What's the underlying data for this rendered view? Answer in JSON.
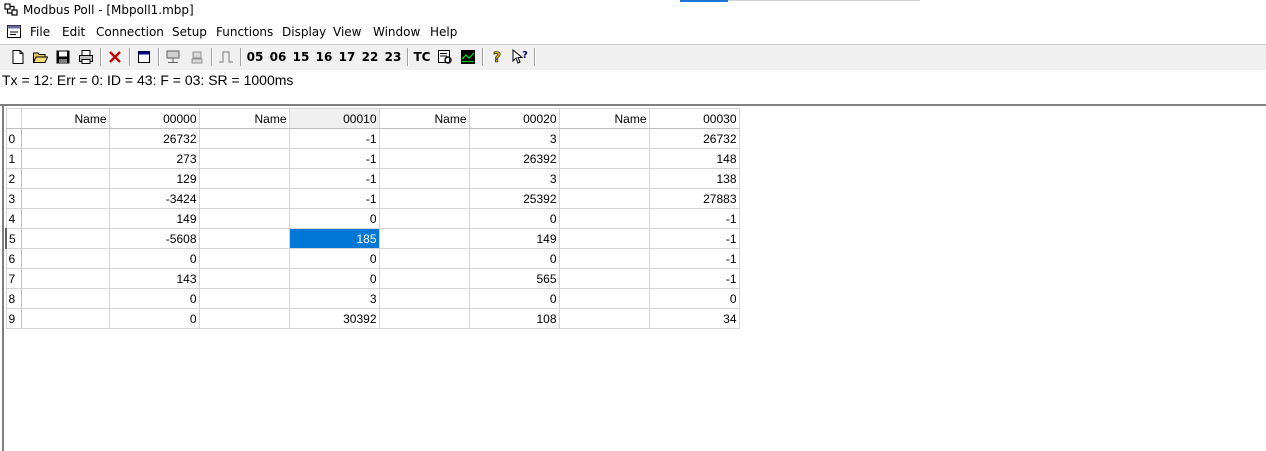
{
  "window": {
    "title": "Modbus Poll - [Mbpoll1.mbp]",
    "app_icon": "modbus-app-icon",
    "accent_color": "#1e73d6"
  },
  "menubar": {
    "doc_icon": "document-icon",
    "items": [
      "File",
      "Edit",
      "Connection",
      "Setup",
      "Functions",
      "Display",
      "View",
      "Window",
      "Help"
    ]
  },
  "toolbar": {
    "icons": [
      "new-icon",
      "open-icon",
      "save-icon",
      "print-icon",
      "delete-icon",
      "window-icon",
      "connect-icon",
      "disconnect-icon",
      "pulse-icon",
      "traffic-icon",
      "chart-icon",
      "help-icon",
      "context-help-icon"
    ],
    "function_codes": [
      "05",
      "06",
      "15",
      "16",
      "17",
      "22",
      "23"
    ],
    "tc_label": "TC"
  },
  "status": {
    "text": "Tx = 12: Err = 0: ID = 43: F = 03: SR = 1000ms"
  },
  "grid": {
    "header_name": "Name",
    "column_addresses": [
      "00000",
      "00010",
      "00020",
      "00030"
    ],
    "active_column_index": 1,
    "selected_cell": {
      "row": 5,
      "col": 1
    },
    "selection_color": "#0078d7",
    "rows": [
      {
        "index": "0",
        "values": [
          "26732",
          "-1",
          "3",
          "26732"
        ]
      },
      {
        "index": "1",
        "values": [
          "273",
          "-1",
          "26392",
          "148"
        ]
      },
      {
        "index": "2",
        "values": [
          "129",
          "-1",
          "3",
          "138"
        ]
      },
      {
        "index": "3",
        "values": [
          "-3424",
          "-1",
          "25392",
          "27883"
        ]
      },
      {
        "index": "4",
        "values": [
          "149",
          "0",
          "0",
          "-1"
        ]
      },
      {
        "index": "5",
        "values": [
          "-5608",
          "185",
          "149",
          "-1"
        ]
      },
      {
        "index": "6",
        "values": [
          "0",
          "0",
          "0",
          "-1"
        ]
      },
      {
        "index": "7",
        "values": [
          "143",
          "0",
          "565",
          "-1"
        ]
      },
      {
        "index": "8",
        "values": [
          "0",
          "3",
          "0",
          "0"
        ]
      },
      {
        "index": "9",
        "values": [
          "0",
          "30392",
          "108",
          "34"
        ]
      }
    ]
  }
}
